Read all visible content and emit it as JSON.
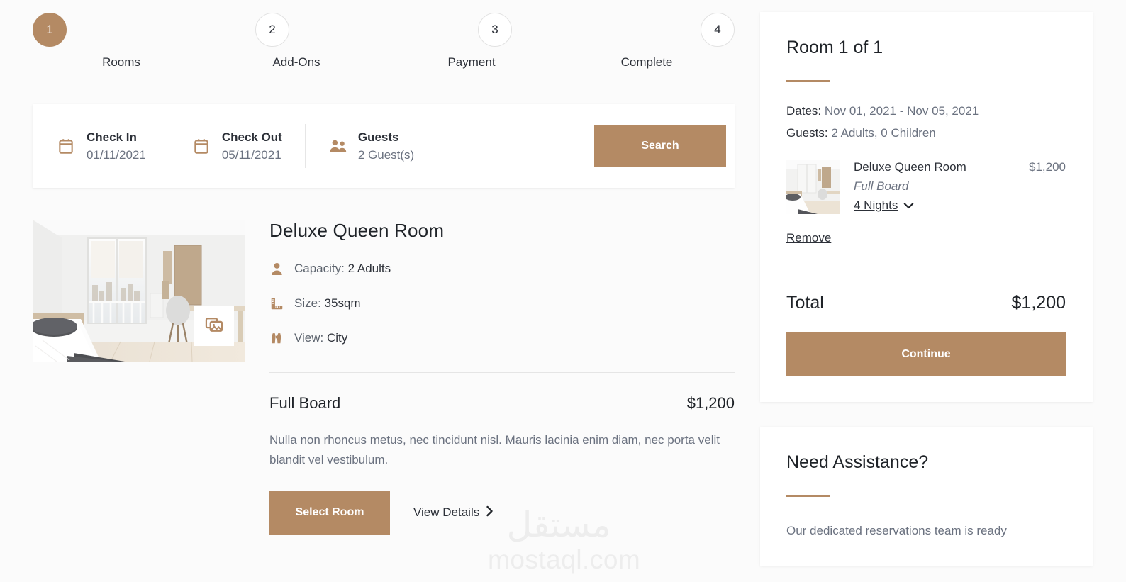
{
  "colors": {
    "accent": "#b48a64",
    "page_bg": "#fbfbfb",
    "card_bg": "#ffffff",
    "text_dark": "#2c3038",
    "text_muted": "#6b7280",
    "divider": "#e5e5e5"
  },
  "stepper": {
    "steps": [
      {
        "number": "1",
        "label": "Rooms",
        "state": "active"
      },
      {
        "number": "2",
        "label": "Add-Ons",
        "state": "inactive"
      },
      {
        "number": "3",
        "label": "Payment",
        "state": "inactive"
      },
      {
        "number": "4",
        "label": "Complete",
        "state": "inactive"
      }
    ]
  },
  "searchbar": {
    "checkin": {
      "label": "Check In",
      "value": "01/11/2021",
      "icon": "calendar-icon"
    },
    "checkout": {
      "label": "Check Out",
      "value": "05/11/2021",
      "icon": "calendar-icon"
    },
    "guests": {
      "label": "Guests",
      "value": "2 Guest(s)",
      "icon": "guests-icon"
    },
    "search_button": "Search"
  },
  "room": {
    "title": "Deluxe Queen Room",
    "gallery_icon": "images-icon",
    "features": [
      {
        "icon": "person-icon",
        "label": "Capacity:",
        "value": "2 Adults"
      },
      {
        "icon": "ruler-icon",
        "label": "Size:",
        "value": "35sqm"
      },
      {
        "icon": "binoculars-icon",
        "label": "View:",
        "value": "City"
      }
    ],
    "board_name": "Full Board",
    "board_price": "$1,200",
    "board_description": "Nulla non rhoncus metus, nec tincidunt nisl. Mauris lacinia enim diam, nec porta velit blandit vel vestibulum.",
    "select_button": "Select Room",
    "view_details": "View Details",
    "view_details_icon": "chevron-right-icon"
  },
  "sidebar": {
    "summary": {
      "title": "Room 1 of 1",
      "dates_label": "Dates:",
      "dates_value": "Nov 01, 2021 - Nov 05, 2021",
      "guests_label": "Guests:",
      "guests_value": "2 Adults, 0 Children",
      "item": {
        "name": "Deluxe Queen Room",
        "price": "$1,200",
        "board": "Full Board",
        "nights": "4 Nights",
        "nights_icon": "chevron-down-icon"
      },
      "remove_link": "Remove",
      "total_label": "Total",
      "total_value": "$1,200",
      "continue_button": "Continue"
    },
    "assistance": {
      "title": "Need Assistance?",
      "text": "Our dedicated reservations team is ready"
    }
  },
  "watermark": {
    "arabic": "مستقل",
    "latin": "mostaql.com"
  }
}
